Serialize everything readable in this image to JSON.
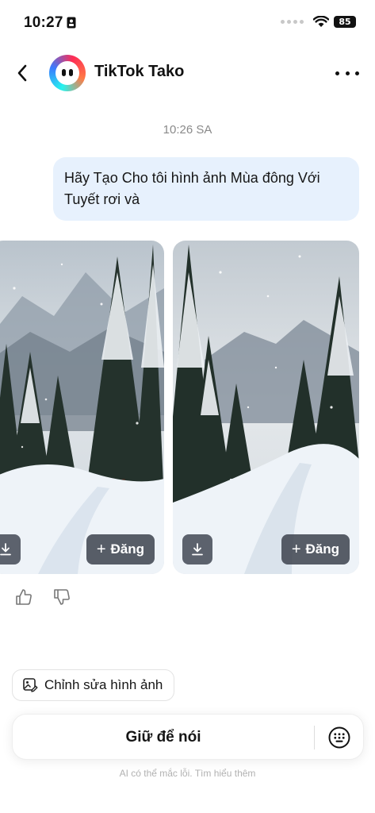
{
  "status_bar": {
    "time": "10:27",
    "battery": "85",
    "icons": [
      "id-card-icon",
      "signal-icon",
      "wifi-icon",
      "battery-icon"
    ]
  },
  "header": {
    "title": "TikTok Tako",
    "icons": [
      "back-icon",
      "tako-avatar",
      "more-icon"
    ]
  },
  "chat": {
    "timestamp": "10:26 SA",
    "user_message": "Hãy Tạo Cho tôi hình ảnh Mùa đông Với Tuyết rơi và",
    "images": [
      {
        "post_label": "Đăng",
        "icons": [
          "download-icon",
          "plus-icon"
        ]
      },
      {
        "post_label": "Đăng",
        "icons": [
          "download-icon",
          "plus-icon"
        ]
      }
    ],
    "feedback_icons": [
      "thumbs-up-icon",
      "thumbs-down-icon"
    ]
  },
  "edit_chip": {
    "label": "Chỉnh sửa hình ảnh",
    "icon": "edit-image-icon"
  },
  "input_bar": {
    "label": "Giữ để nói",
    "icon": "keyboard-icon"
  },
  "disclaimer": "AI có thể mắc lỗi. Tìm hiểu thêm",
  "colors": {
    "user_bubble": "#e7f1fd",
    "button_overlay": "#3c424e",
    "timestamp": "#8a8a8a"
  }
}
